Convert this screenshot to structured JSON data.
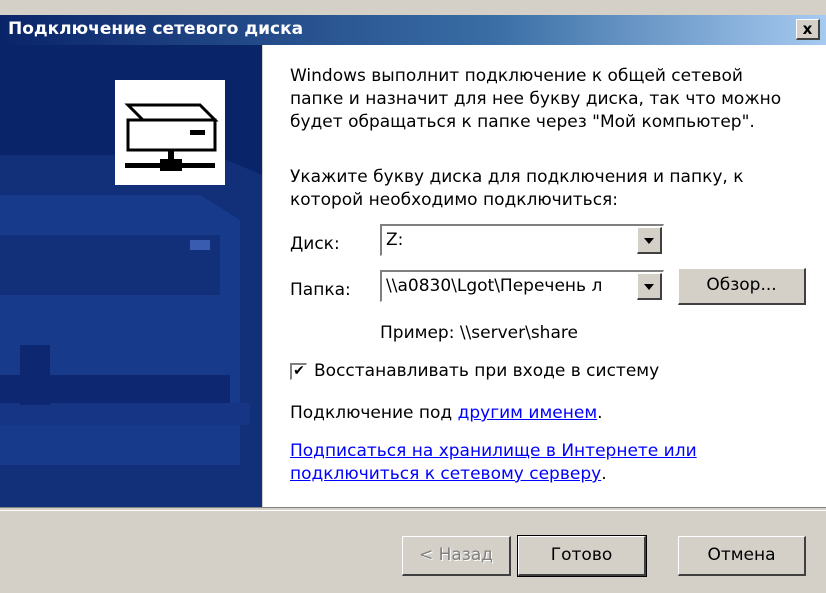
{
  "dialog": {
    "title": "Подключение сетевого диска",
    "close_label": "x"
  },
  "content": {
    "intro_line1": "Windows выполнит подключение к общей сетевой",
    "intro_line2": "папке и назначит для нее букву диска, так что можно",
    "intro_line3": "будет обращаться к папке через \"Мой компьютер\".",
    "instruction_line1": "Укажите букву диска для подключения и папку, к",
    "instruction_line2": "которой необходимо подключиться:",
    "disk_label": "Диск:",
    "disk_value": "Z:",
    "folder_label": "Папка:",
    "folder_value": "\\\\a0830\\Lgot\\Перечень л",
    "browse_label": "Обзор...",
    "example": "Пример: \\\\server\\share",
    "reconnect_label": "Восстанавливать при входе в систему",
    "reconnect_checked": true,
    "connect_as_prefix": "Подключение под ",
    "connect_as_link": "другим именем",
    "connect_as_suffix": ".",
    "signup_link_line1": "Подписаться на хранилище в Интернете или",
    "signup_link_line2": "подключиться к сетевому серверу",
    "signup_suffix": "."
  },
  "footer": {
    "back_label": "< Назад",
    "finish_label": "Готово",
    "cancel_label": "Отмена"
  }
}
